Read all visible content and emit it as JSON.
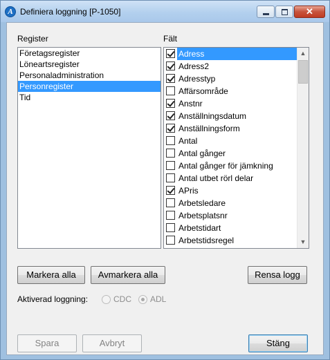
{
  "window": {
    "title": "Definiera loggning [P-1050]"
  },
  "register": {
    "label": "Register",
    "items": [
      {
        "label": "Företagsregister",
        "selected": false
      },
      {
        "label": "Löneartsregister",
        "selected": false
      },
      {
        "label": "Personaladministration",
        "selected": false
      },
      {
        "label": "Personregister",
        "selected": true
      },
      {
        "label": "Tid",
        "selected": false
      }
    ]
  },
  "fields": {
    "label": "Fält",
    "items": [
      {
        "label": "Adress",
        "checked": true,
        "selected": true
      },
      {
        "label": "Adress2",
        "checked": true
      },
      {
        "label": "Adresstyp",
        "checked": true
      },
      {
        "label": "Affärsområde",
        "checked": false
      },
      {
        "label": "Anstnr",
        "checked": true
      },
      {
        "label": "Anställningsdatum",
        "checked": true
      },
      {
        "label": "Anställningsform",
        "checked": true
      },
      {
        "label": "Antal",
        "checked": false
      },
      {
        "label": "Antal gånger",
        "checked": false
      },
      {
        "label": "Antal gånger för jämkning",
        "checked": false
      },
      {
        "label": "Antal utbet rörl delar",
        "checked": false
      },
      {
        "label": "APris",
        "checked": true
      },
      {
        "label": "Arbetsledare",
        "checked": false
      },
      {
        "label": "Arbetsplatsnr",
        "checked": false
      },
      {
        "label": "Arbetstidart",
        "checked": false
      },
      {
        "label": "Arbetstidsregel",
        "checked": false
      }
    ]
  },
  "buttons": {
    "mark_all": "Markera alla",
    "unmark_all": "Avmarkera alla",
    "clear_log": "Rensa logg",
    "save": "Spara",
    "cancel": "Avbryt",
    "close": "Stäng"
  },
  "logging": {
    "label": "Aktiverad loggning:",
    "options": [
      {
        "label": "CDC",
        "selected": false
      },
      {
        "label": "ADL",
        "selected": true
      }
    ]
  },
  "colors": {
    "selection": "#3399ff",
    "titlebar": "#b3d0ee"
  }
}
